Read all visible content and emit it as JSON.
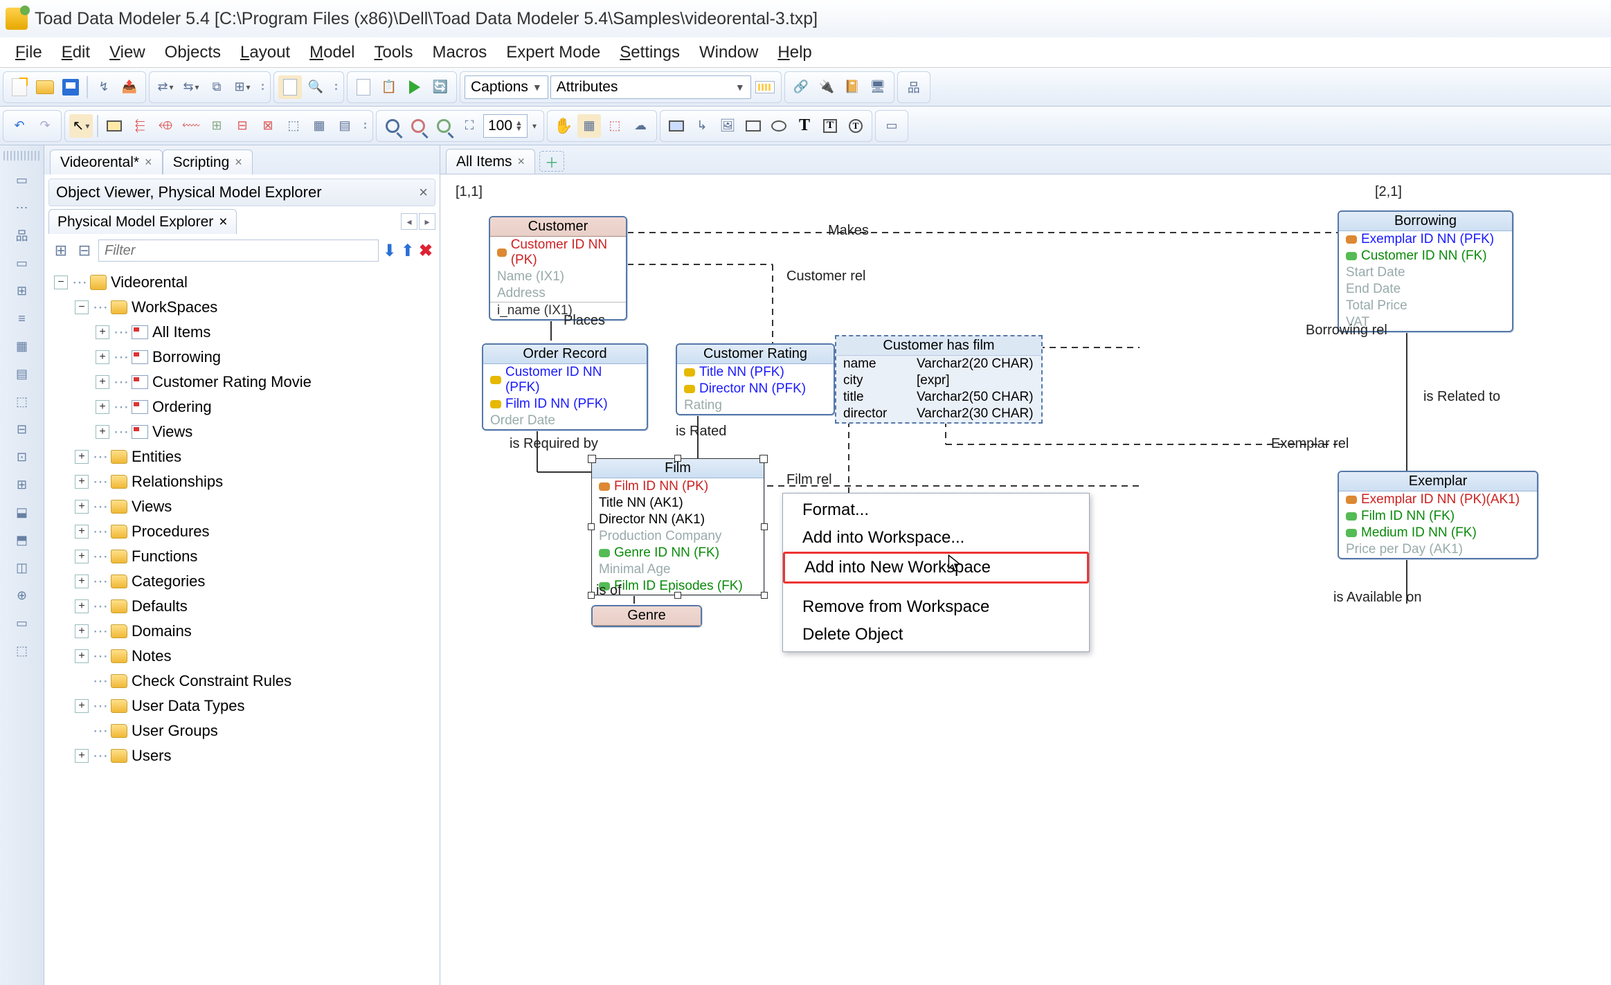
{
  "title": "Toad Data Modeler 5.4   [C:\\Program Files (x86)\\Dell\\Toad Data Modeler 5.4\\Samples\\videorental-3.txp]",
  "menu": [
    "File",
    "Edit",
    "View",
    "Objects",
    "Layout",
    "Model",
    "Tools",
    "Macros",
    "Expert Mode",
    "Settings",
    "Window",
    "Help"
  ],
  "combo_captions": "Captions",
  "combo_attributes": "Attributes",
  "zoom_value": "100",
  "doc_tabs": [
    {
      "label": "Videorental*",
      "close": true
    },
    {
      "label": "Scripting",
      "close": true
    }
  ],
  "panel_header": "Object Viewer, Physical Model Explorer",
  "explorer_tab": "Physical Model Explorer",
  "filter_placeholder": "Filter",
  "tree": {
    "root": "Videorental",
    "workspaces_label": "WorkSpaces",
    "workspaces": [
      "All Items",
      "Borrowing",
      "Customer Rating Movie",
      "Ordering",
      "Views"
    ],
    "folders": [
      "Entities",
      "Relationships",
      "Views",
      "Procedures",
      "Functions",
      "Categories",
      "Defaults",
      "Domains",
      "Notes",
      "Check Constraint Rules",
      "User Data Types",
      "User Groups",
      "Users"
    ]
  },
  "canvas_tab": "All Items",
  "coord_tl": "[1,1]",
  "coord_tr": "[2,1]",
  "entities": {
    "customer": {
      "title": "Customer",
      "rows": [
        {
          "k": "red",
          "t": "Customer ID NN  (PK)",
          "cls": "pk"
        },
        {
          "k": "",
          "t": "Name  (IX1)",
          "cls": "gray"
        },
        {
          "k": "",
          "t": "Address",
          "cls": "gray"
        }
      ],
      "idx": "i_name (IX1)"
    },
    "order": {
      "title": "Order Record",
      "rows": [
        {
          "k": "gold",
          "t": "Customer ID NN  (PFK)",
          "cls": "nn"
        },
        {
          "k": "gold",
          "t": "Film ID NN  (PFK)",
          "cls": "nn"
        },
        {
          "k": "",
          "t": "Order Date",
          "cls": "gray"
        }
      ]
    },
    "rating": {
      "title": "Customer Rating",
      "rows": [
        {
          "k": "gold",
          "t": "Title NN  (PFK)",
          "cls": "nn"
        },
        {
          "k": "gold",
          "t": "Director NN  (PFK)",
          "cls": "nn"
        },
        {
          "k": "",
          "t": "Rating",
          "cls": "gray"
        }
      ]
    },
    "film": {
      "title": "Film",
      "rows": [
        {
          "k": "red",
          "t": "Film ID NN  (PK)",
          "cls": "pk"
        },
        {
          "k": "",
          "t": "Title NN (AK1)",
          "cls": ""
        },
        {
          "k": "",
          "t": "Director NN (AK1)",
          "cls": ""
        },
        {
          "k": "",
          "t": "Production Company",
          "cls": "gray"
        },
        {
          "k": "grn",
          "t": "Genre ID NN  (FK)",
          "cls": "fk"
        },
        {
          "k": "",
          "t": "Minimal Age",
          "cls": "gray"
        },
        {
          "k": "grn",
          "t": "Film ID Episodes   (FK)",
          "cls": "fk"
        }
      ]
    },
    "genre": {
      "title": "Genre"
    },
    "borrowing": {
      "title": "Borrowing",
      "rows": [
        {
          "k": "red",
          "t": "Exemplar ID NN  (PFK)",
          "cls": "nn"
        },
        {
          "k": "grn",
          "t": "Customer ID NN  (FK)",
          "cls": "fk"
        },
        {
          "k": "",
          "t": "Start Date",
          "cls": "gray"
        },
        {
          "k": "",
          "t": "End Date",
          "cls": "gray"
        },
        {
          "k": "",
          "t": "Total Price",
          "cls": "gray"
        },
        {
          "k": "",
          "t": "VAT",
          "cls": "gray"
        }
      ]
    },
    "exemplar": {
      "title": "Exemplar",
      "rows": [
        {
          "k": "red",
          "t": "Exemplar ID NN  (PK)(AK1)",
          "cls": "pk"
        },
        {
          "k": "grn",
          "t": "Film ID NN  (FK)",
          "cls": "fk"
        },
        {
          "k": "grn",
          "t": "Medium ID NN  (FK)",
          "cls": "fk"
        },
        {
          "k": "",
          "t": "Price per Day  (AK1)",
          "cls": "gray"
        }
      ]
    }
  },
  "view": {
    "title": "Customer has film",
    "rows": [
      [
        "name",
        "Varchar2(20 CHAR)"
      ],
      [
        "city",
        "[expr]"
      ],
      [
        "title",
        "Varchar2(50 CHAR)"
      ],
      [
        "director",
        "Varchar2(30 CHAR)"
      ]
    ]
  },
  "rel_labels": {
    "makes": "Makes",
    "custrel": "Customer rel",
    "places": "Places",
    "reqby": "is Required by",
    "israted": "is Rated",
    "filmrel": "Film rel",
    "isof": "is of",
    "borrowrel": "Borrowing rel",
    "related": "is Related to",
    "exemrel": "Exemplar rel",
    "avail": "is Available on"
  },
  "context_menu": [
    "Format...",
    "Add into Workspace...",
    "Add into New Workspace",
    "Remove from Workspace",
    "Delete Object"
  ]
}
